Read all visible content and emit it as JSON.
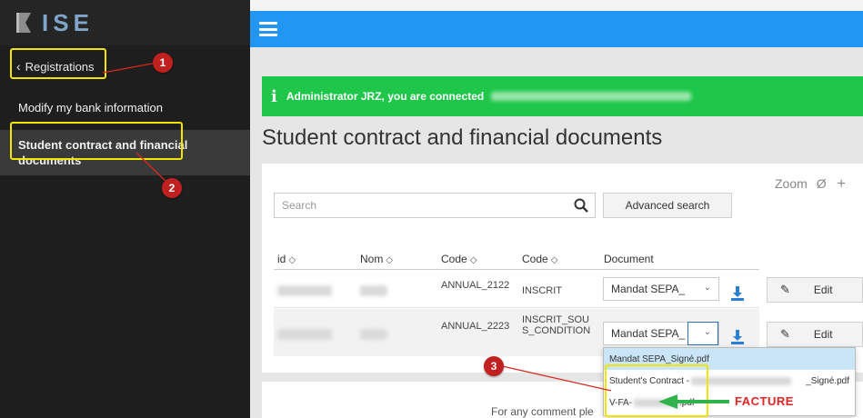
{
  "brand": {
    "name": "ISE"
  },
  "sidebar": {
    "back_label": "Registrations",
    "items": [
      {
        "label": "Modify my bank information"
      },
      {
        "label": "Student contract and financial documents"
      }
    ]
  },
  "alert": {
    "text": "Administrator JRZ, you are connected"
  },
  "page": {
    "title": "Student contract and financial documents"
  },
  "toolbar": {
    "zoom_label": "Zoom",
    "zoom_reset": "Ø",
    "zoom_in": "+",
    "search_placeholder": "Search",
    "advanced_search": "Advanced search"
  },
  "table": {
    "columns": [
      {
        "label": "id",
        "sort": "◇"
      },
      {
        "label": "Nom",
        "sort": "◇"
      },
      {
        "label": "Code",
        "sort": "◇"
      },
      {
        "label": "Code",
        "sort": "◇"
      },
      {
        "label": "Document"
      }
    ],
    "rows": [
      {
        "code1": "ANNUAL_2122",
        "code2": "INSCRIT",
        "document": "Mandat SEPA_",
        "edit": "Edit"
      },
      {
        "code1": "ANNUAL_2223",
        "code2": "INSCRIT_SOUS_CONDITION",
        "document": "Mandat SEPA_",
        "edit": "Edit"
      }
    ]
  },
  "dropdown": {
    "options": [
      {
        "label": "Mandat SEPA_Signé.pdf"
      },
      {
        "prefix": "Student's Contract -",
        "suffix": "_Signé.pdf"
      },
      {
        "prefix": "V-FA-",
        "suffix": ".pdf"
      }
    ]
  },
  "annotations": {
    "badge1": "1",
    "badge2": "2",
    "badge3": "3",
    "facture": "FACTURE"
  },
  "footer": {
    "text": "For any comment ple"
  },
  "colors": {
    "topbar": "#2196f3",
    "alert": "#1ec74a",
    "sidebar": "#1e1e1e",
    "highlight": "#f2e500",
    "badge": "#c0201f",
    "arrow": "#2fb34a"
  }
}
